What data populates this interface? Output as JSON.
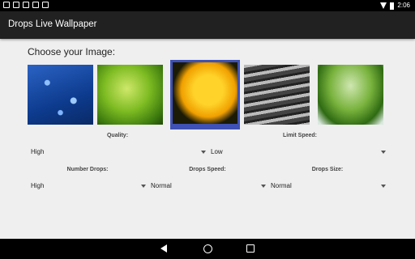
{
  "status_bar": {
    "time": "2:06"
  },
  "app_bar": {
    "title": "Drops Live Wallpaper"
  },
  "main": {
    "choose_label": "Choose your Image:",
    "images": [
      {
        "name": "blue-drops-image",
        "selected": false
      },
      {
        "name": "green-leaf-image",
        "selected": false
      },
      {
        "name": "yellow-flower-image",
        "selected": true
      },
      {
        "name": "gray-drops-image",
        "selected": false
      },
      {
        "name": "green-leaf-drops-image",
        "selected": false
      }
    ],
    "quality": {
      "label": "Quality:",
      "value": "High"
    },
    "limit_speed": {
      "label": "Limit Speed:",
      "value": "Low"
    },
    "number_drops": {
      "label": "Number Drops:",
      "value": "High"
    },
    "drops_speed": {
      "label": "Drops Speed:",
      "value": "Normal"
    },
    "drops_size": {
      "label": "Drops Size:",
      "value": "Normal"
    }
  },
  "colors": {
    "accent": "#3f51b5",
    "app_bar": "#212121"
  }
}
